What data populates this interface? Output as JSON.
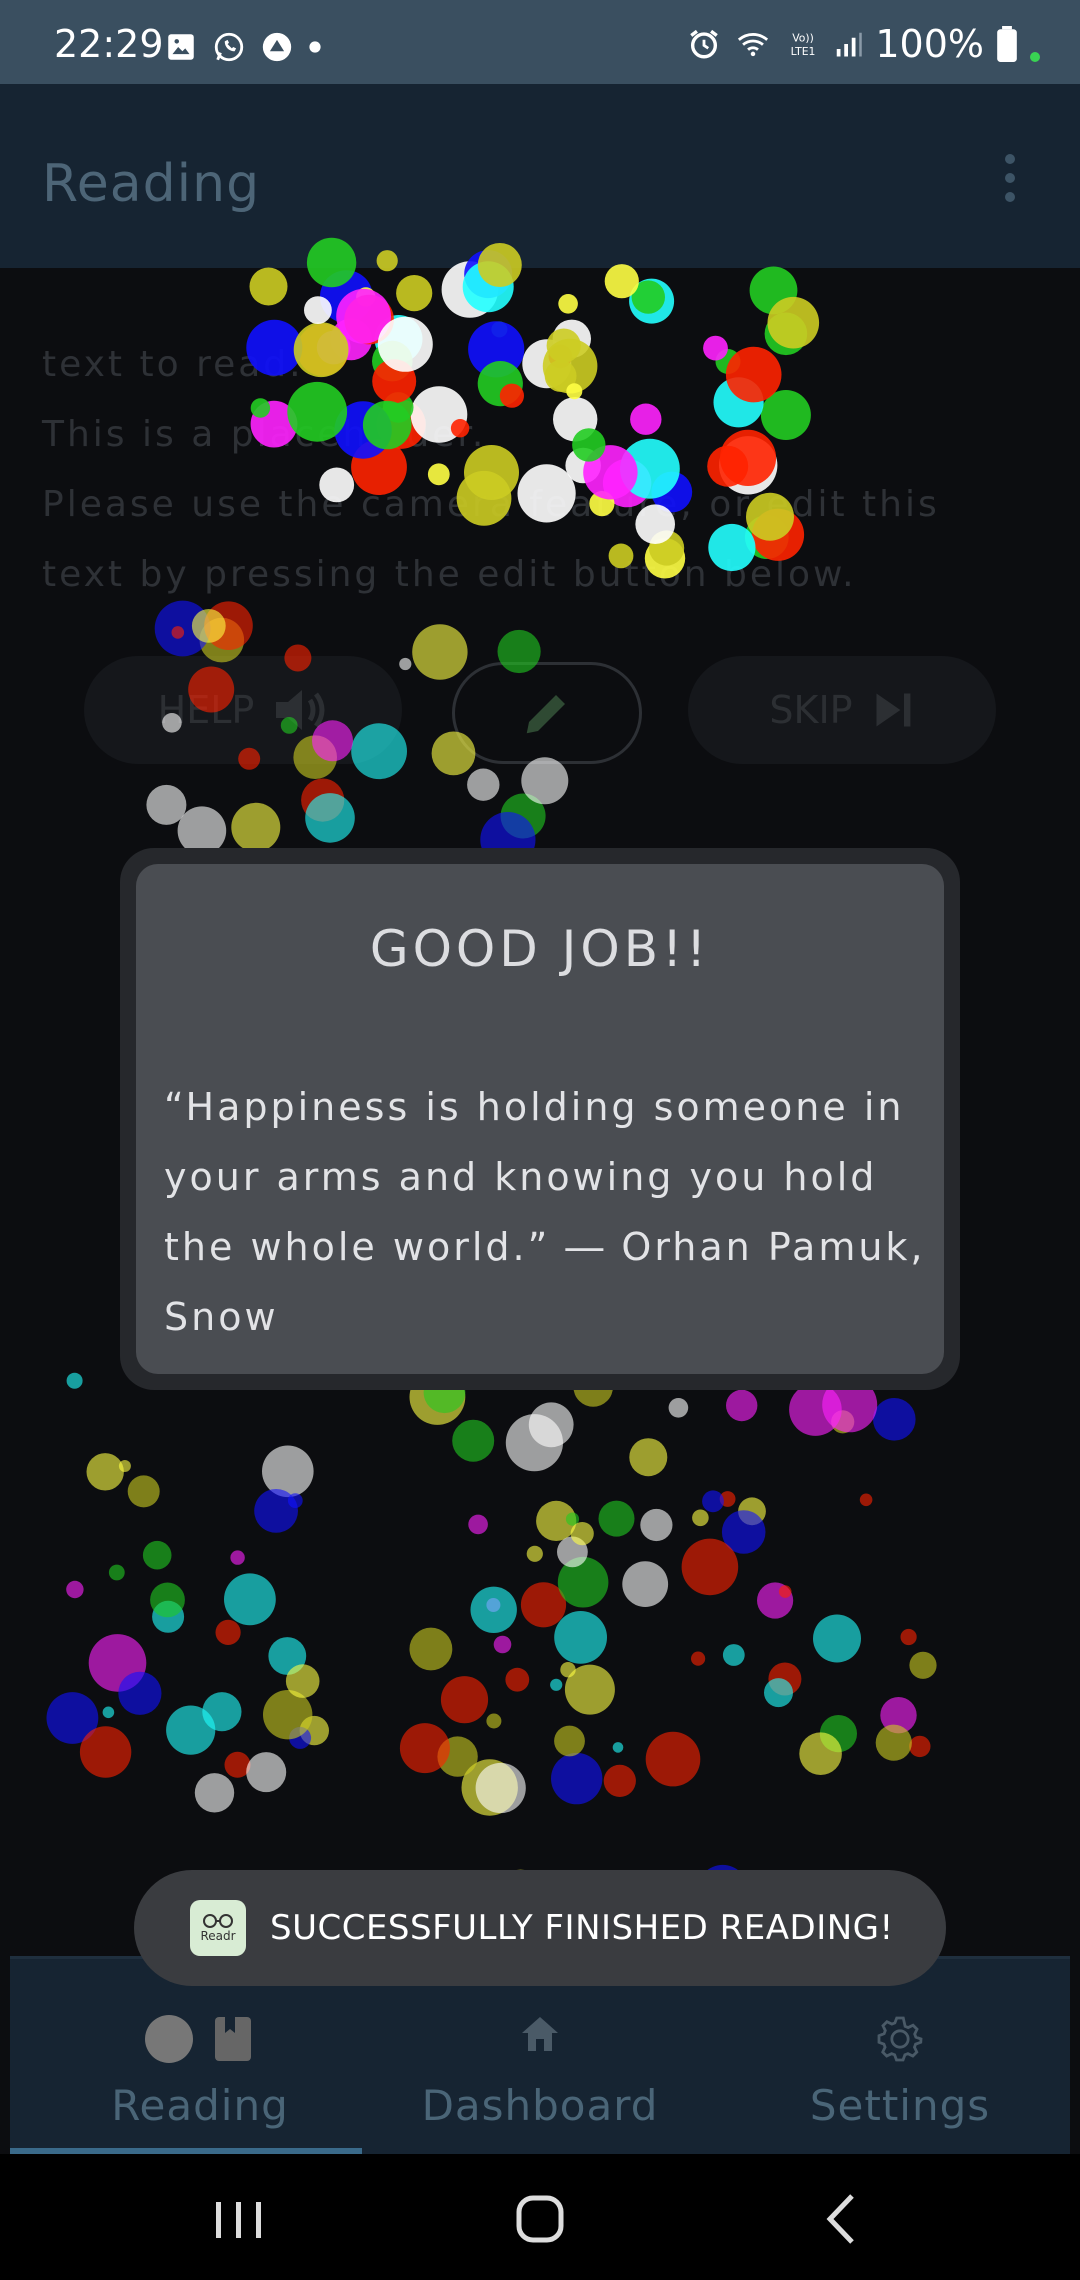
{
  "status_bar": {
    "time": "22:29",
    "battery": "100%",
    "left_icons": [
      "gallery-icon",
      "whatsapp-icon",
      "app-icon",
      "dot-icon"
    ],
    "right_icons": [
      "alarm-icon",
      "wifi-icon",
      "volte-icon",
      "signal-icon",
      "battery-icon"
    ]
  },
  "app_bar": {
    "title": "Reading",
    "menu_icon": "more-vert-icon"
  },
  "reading": {
    "lines": [
      "text to read.",
      "This is a placeholder.",
      "Please use the camera feature, or edit this",
      "text by pressing the edit button below."
    ],
    "help_label": "HELP",
    "skip_label": "SKIP",
    "edit_icon": "pencil-icon"
  },
  "dialog": {
    "title": "GOOD JOB!!",
    "quote_lines": [
      "“Happiness is holding someone in",
      "your arms and knowing you hold",
      "the whole world.” ― Orhan Pamuk,",
      "Snow"
    ]
  },
  "toast": {
    "logo_text": "Readr",
    "message": "SUCCESSFULLY FINISHED READING!"
  },
  "bottom_nav": {
    "items": [
      {
        "label": "Reading",
        "icon": "book-icon"
      },
      {
        "label": "Dashboard",
        "icon": "home-icon"
      },
      {
        "label": "Settings",
        "icon": "gear-icon"
      }
    ],
    "selected": "Reading"
  },
  "system_nav": {
    "buttons": [
      "recent-apps-icon",
      "home-circle-icon",
      "back-icon"
    ]
  },
  "colors": {
    "accent": "#3a6a8a",
    "app_bar": "#162432",
    "status_bar": "#3a4f60",
    "confetti": [
      "#ffff44",
      "#22cc22",
      "#1010ff",
      "#ff22ff",
      "#ffffff",
      "#ff2200",
      "#22ffff",
      "#cccc22"
    ]
  }
}
